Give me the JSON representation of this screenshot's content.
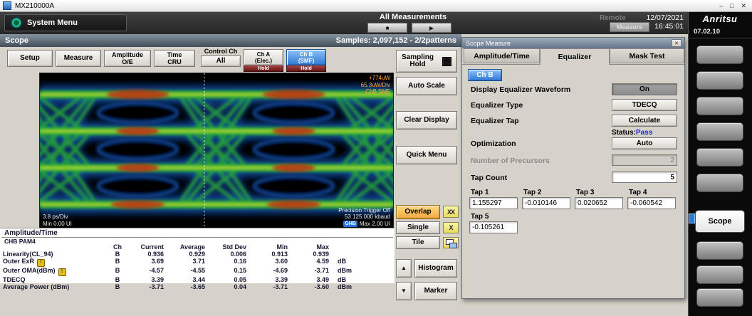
{
  "window": {
    "title": "MX210000A"
  },
  "icons": {
    "minimize": "–",
    "maximize": "□",
    "close": "✕",
    "stop": "■",
    "play": "▶",
    "up": "▲",
    "down": "▼",
    "overlap": "XX",
    "single": "X",
    "warning": "!",
    "dialog_close": "✕"
  },
  "topbar": {
    "system_menu": "System Menu",
    "all_measurements": "All Measurements",
    "remote": "Remote",
    "measure": "Measure",
    "date": "12/07/2021",
    "time": "16:45:01"
  },
  "right_panel": {
    "logo": "Anritsu",
    "version": "07.02.10",
    "scope_key": "Scope"
  },
  "scope_bar": {
    "title": "Scope",
    "samples": "Samples: 2,097,152 - 2/2patterns"
  },
  "toolbar": {
    "setup": "Setup",
    "measure": "Measure",
    "amplitude": "Amplitude\nO/E",
    "time": "Time\nCRU",
    "control_label": "Control Ch",
    "control_value": "All",
    "ch_a": "Ch A\n(Elec.)",
    "ch_a_hold": "Hold",
    "ch_b": "Ch B\n(SMF)",
    "ch_b_hold": "Hold"
  },
  "eye": {
    "power": "+774uW",
    "scale_v": "65.3uW/Div",
    "channel": "ChB  SMF",
    "scale_h": "3.8 ps/Div",
    "min_ui": "Min 0.00 UI",
    "trigger": "Precision Trigger Off",
    "baud": "53 125 000 kbaud",
    "badge": "GHB",
    "max_ui": "Max 2.00 UI"
  },
  "side": {
    "sampling_hold": "Sampling\nHold",
    "auto_scale": "Auto Scale",
    "clear_display": "Clear Display",
    "quick_menu": "Quick Menu",
    "overlap": "Overlap",
    "single": "Single",
    "tile": "Tile",
    "histogram": "Histogram",
    "marker": "Marker"
  },
  "table": {
    "title": "Amplitude/Time",
    "subtitle": "CHB PAM4",
    "headers": {
      "ch": "Ch",
      "current": "Current",
      "average": "Average",
      "std": "Std Dev",
      "min": "Min",
      "max": "Max"
    },
    "rows": [
      {
        "name": "Linearity(CL_94)",
        "ch": "B",
        "current": "0.936",
        "average": "0.929",
        "std": "0.006",
        "min": "0.913",
        "max": "0.939",
        "unit": ""
      },
      {
        "name": "Outer ExR",
        "ch": "B",
        "current": "3.69",
        "average": "3.71",
        "std": "0.16",
        "min": "3.60",
        "max": "4.59",
        "unit": "dB"
      },
      {
        "name": "Outer OMA(dBm)",
        "ch": "B",
        "current": "-4.57",
        "average": "-4.55",
        "std": "0.15",
        "min": "-4.69",
        "max": "-3.71",
        "unit": "dBm"
      },
      {
        "name": "TDECQ",
        "ch": "B",
        "current": "3.39",
        "average": "3.44",
        "std": "0.05",
        "min": "3.39",
        "max": "3.49",
        "unit": "dB"
      },
      {
        "name": "Average Power (dBm)",
        "ch": "B",
        "current": "-3.71",
        "average": "-3.65",
        "std": "0.04",
        "min": "-3.71",
        "max": "-3.60",
        "unit": "dBm"
      }
    ]
  },
  "dialog": {
    "title": "Scope Measure",
    "tabs": {
      "amplitude": "Amplitude/Time",
      "equalizer": "Equalizer",
      "mask": "Mask Test"
    },
    "channel": "Ch B",
    "display_eq_label": "Display Equalizer Waveform",
    "display_eq_value": "On",
    "eq_type_label": "Equalizer Type",
    "eq_type_value": "TDECQ",
    "eq_tap_label": "Equalizer Tap",
    "eq_tap_value": "Calculate",
    "status_label": "Status:",
    "status_value": "Pass",
    "optimization_label": "Optimization",
    "optimization_value": "Auto",
    "precursors_label": "Number of Precursors",
    "precursors_value": "2",
    "tap_count_label": "Tap Count",
    "tap_count_value": "5",
    "taps": [
      {
        "label": "Tap 1",
        "value": "1.155297"
      },
      {
        "label": "Tap 2",
        "value": "-0.010146"
      },
      {
        "label": "Tap 3",
        "value": "0.020652"
      },
      {
        "label": "Tap 4",
        "value": "-0.060542"
      },
      {
        "label": "Tap 5",
        "value": "-0.105261"
      }
    ]
  }
}
